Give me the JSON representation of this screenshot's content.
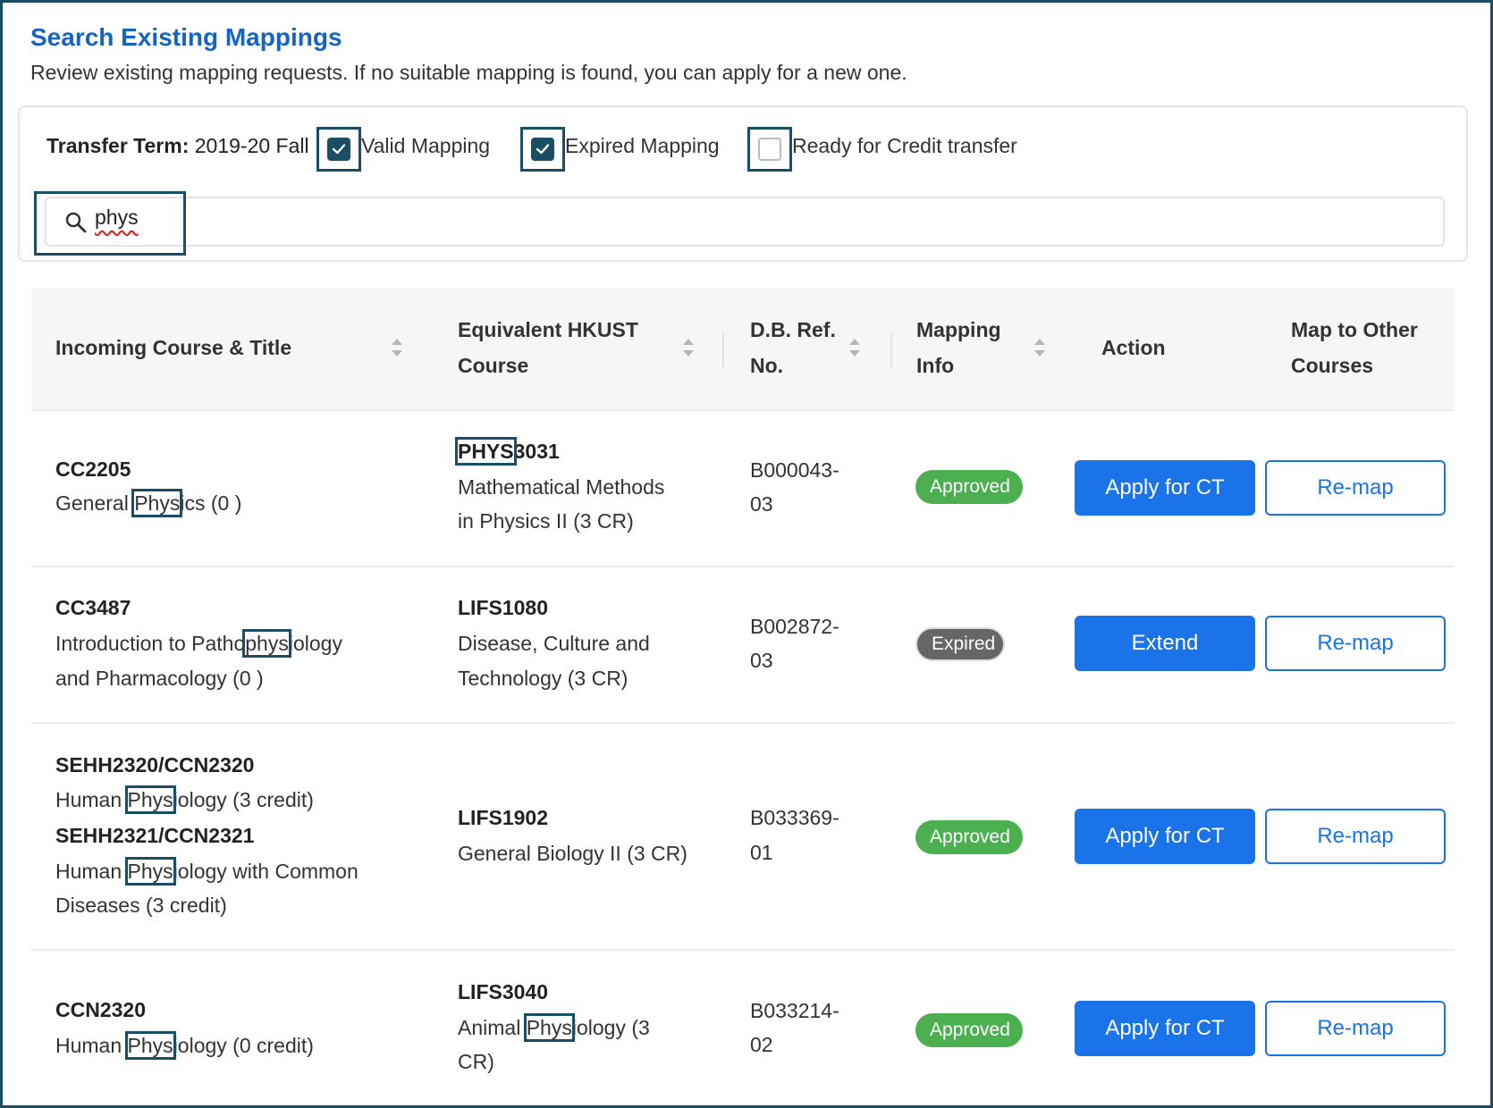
{
  "header": {
    "title": "Search Existing Mappings",
    "subtitle": "Review existing mapping requests. If no suitable mapping is found, you can apply for a new one."
  },
  "filters": {
    "term_label": "Transfer Term:",
    "term_value": "2019-20 Fall",
    "checkboxes": [
      {
        "label": "Valid Mapping",
        "checked": true
      },
      {
        "label": "Expired Mapping",
        "checked": true
      },
      {
        "label": "Ready for Credit transfer",
        "checked": false
      }
    ],
    "search_value": "phys",
    "search_icon": "search-icon"
  },
  "table": {
    "columns": [
      {
        "line1": "Incoming Course & Title",
        "line2": ""
      },
      {
        "line1": "Equivalent HKUST",
        "line2": "Course"
      },
      {
        "line1": "D.B. Ref.",
        "line2": "No."
      },
      {
        "line1": "Mapping",
        "line2": "Info"
      },
      {
        "line1": "Action",
        "line2": ""
      },
      {
        "line1": "Map to Other",
        "line2": "Courses"
      }
    ],
    "rows": [
      {
        "incoming": [
          {
            "code": "CC2205",
            "title_pre": "General ",
            "title_hl": "Phys",
            "title_post": "ics (0 )",
            "title_line2": ""
          }
        ],
        "equiv_code_hl": "PHYS",
        "equiv_code_post": "3031",
        "equiv_title_line1": "Mathematical Methods",
        "equiv_title_line2": "in Physics II (3 CR)",
        "ref_line1": "B000043-",
        "ref_line2": "03",
        "status": "Approved",
        "status_color": "#4caf50",
        "action": "Apply for CT",
        "remap": "Re-map"
      },
      {
        "incoming": [
          {
            "code": "CC3487",
            "title_pre": "Introduction to Patho",
            "title_hl": "phys",
            "title_post": "iology",
            "title_line2": "and Pharmacology (0 )"
          }
        ],
        "equiv_code": "LIFS1080",
        "equiv_title_line1": "Disease, Culture and",
        "equiv_title_line2": "Technology (3 CR)",
        "ref_line1": "B002872-",
        "ref_line2": "03",
        "status": "Expired",
        "status_color": "#666666",
        "action": "Extend",
        "remap": "Re-map"
      },
      {
        "incoming": [
          {
            "code": "SEHH2320/CCN2320",
            "title_pre": "Human ",
            "title_hl": "Phys",
            "title_post": "iology (3 credit)",
            "title_line2": ""
          },
          {
            "code": "SEHH2321/CCN2321",
            "title_pre": "Human ",
            "title_hl": "Phys",
            "title_post": "iology with Common",
            "title_line2": "Diseases (3 credit)"
          }
        ],
        "equiv_code": "LIFS1902",
        "equiv_title_line1": "General Biology II (3 CR)",
        "equiv_title_line2": "",
        "ref_line1": "B033369-",
        "ref_line2": "01",
        "status": "Approved",
        "status_color": "#4caf50",
        "action": "Apply for CT",
        "remap": "Re-map"
      },
      {
        "incoming": [
          {
            "code": "CCN2320",
            "title_pre": "Human ",
            "title_hl": "Phys",
            "title_post": "iology (0 credit)",
            "title_line2": ""
          }
        ],
        "equiv_code": "LIFS3040",
        "equiv_title_pre": "Animal ",
        "equiv_title_hl": "Phys",
        "equiv_title_post": "iology (3",
        "equiv_title_line2": "CR)",
        "ref_line1": "B033214-",
        "ref_line2": "02",
        "status": "Approved",
        "status_color": "#4caf50",
        "action": "Apply for CT",
        "remap": "Re-map"
      }
    ]
  }
}
